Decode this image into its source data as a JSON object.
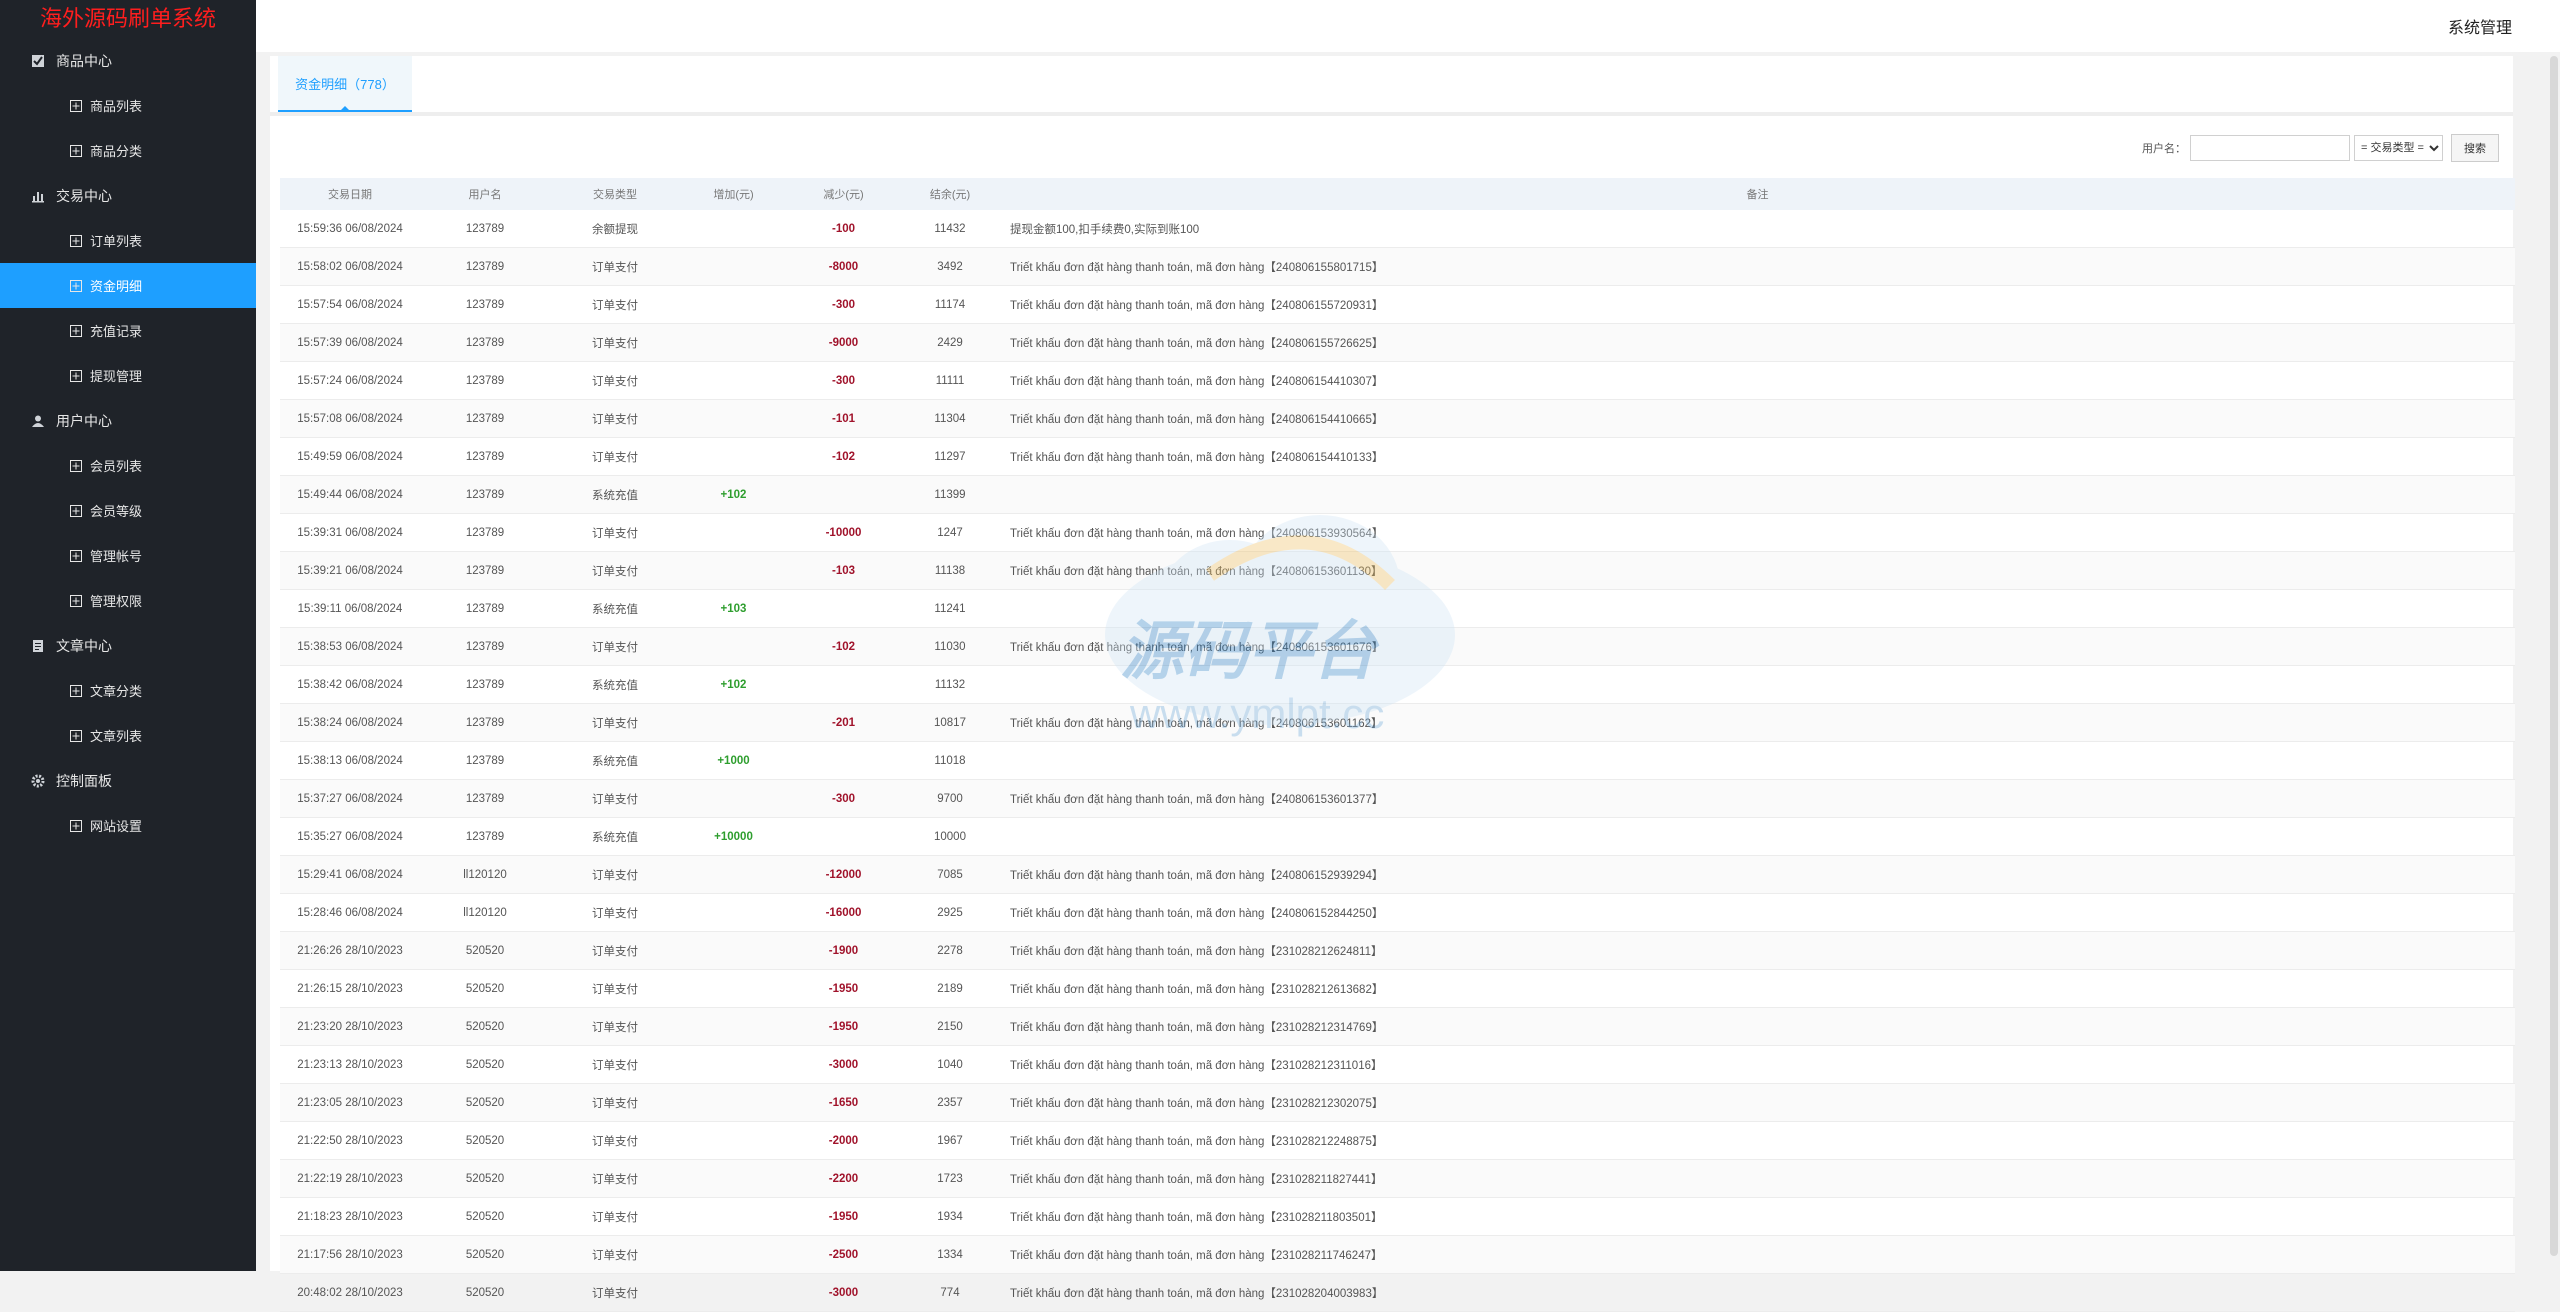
{
  "brand": "海外源码刷单系统",
  "header": {
    "title": "系统管理"
  },
  "sidebar": [
    {
      "label": "商品中心",
      "icon": "checkbox-icon",
      "items": [
        {
          "label": "商品列表"
        },
        {
          "label": "商品分类"
        }
      ]
    },
    {
      "label": "交易中心",
      "icon": "bar-chart-icon",
      "items": [
        {
          "label": "订单列表"
        },
        {
          "label": "资金明细",
          "active": true
        },
        {
          "label": "充值记录"
        },
        {
          "label": "提现管理"
        }
      ]
    },
    {
      "label": "用户中心",
      "icon": "user-icon",
      "items": [
        {
          "label": "会员列表"
        },
        {
          "label": "会员等级"
        },
        {
          "label": "管理帐号"
        },
        {
          "label": "管理权限"
        }
      ]
    },
    {
      "label": "文章中心",
      "icon": "document-icon",
      "items": [
        {
          "label": "文章分类"
        },
        {
          "label": "文章列表"
        }
      ]
    },
    {
      "label": "控制面板",
      "icon": "gear-icon",
      "items": [
        {
          "label": "网站设置"
        }
      ]
    }
  ],
  "tab": {
    "label": "资金明细（778）"
  },
  "filter": {
    "username_label": "用户名：",
    "username_value": "",
    "type_select": "= 交易类型 =",
    "search_label": "搜索"
  },
  "table": {
    "headers": [
      "交易日期",
      "用户名",
      "交易类型",
      "增加(元)",
      "减少(元)",
      "结余(元)",
      "备注"
    ],
    "rows": [
      [
        "15:59:36 06/08/2024",
        "123789",
        "余额提现",
        "",
        "-100",
        "11432",
        "提现金额100,扣手续费0,实际到账100"
      ],
      [
        "15:58:02 06/08/2024",
        "123789",
        "订单支付",
        "",
        "-8000",
        "3492",
        "Triết khấu đơn đặt hàng thanh toán, mã đơn hàng【240806155801715】"
      ],
      [
        "15:57:54 06/08/2024",
        "123789",
        "订单支付",
        "",
        "-300",
        "11174",
        "Triết khấu đơn đặt hàng thanh toán, mã đơn hàng【240806155720931】"
      ],
      [
        "15:57:39 06/08/2024",
        "123789",
        "订单支付",
        "",
        "-9000",
        "2429",
        "Triết khấu đơn đặt hàng thanh toán, mã đơn hàng【240806155726625】"
      ],
      [
        "15:57:24 06/08/2024",
        "123789",
        "订单支付",
        "",
        "-300",
        "11111",
        "Triết khấu đơn đặt hàng thanh toán, mã đơn hàng【240806154410307】"
      ],
      [
        "15:57:08 06/08/2024",
        "123789",
        "订单支付",
        "",
        "-101",
        "11304",
        "Triết khấu đơn đặt hàng thanh toán, mã đơn hàng【240806154410665】"
      ],
      [
        "15:49:59 06/08/2024",
        "123789",
        "订单支付",
        "",
        "-102",
        "11297",
        "Triết khấu đơn đặt hàng thanh toán, mã đơn hàng【240806154410133】"
      ],
      [
        "15:49:44 06/08/2024",
        "123789",
        "系统充值",
        "+102",
        "",
        "11399",
        ""
      ],
      [
        "15:39:31 06/08/2024",
        "123789",
        "订单支付",
        "",
        "-10000",
        "1247",
        "Triết khấu đơn đặt hàng thanh toán, mã đơn hàng【240806153930564】"
      ],
      [
        "15:39:21 06/08/2024",
        "123789",
        "订单支付",
        "",
        "-103",
        "11138",
        "Triết khấu đơn đặt hàng thanh toán, mã đơn hàng【240806153601130】"
      ],
      [
        "15:39:11 06/08/2024",
        "123789",
        "系统充值",
        "+103",
        "",
        "11241",
        ""
      ],
      [
        "15:38:53 06/08/2024",
        "123789",
        "订单支付",
        "",
        "-102",
        "11030",
        "Triết khấu đơn đặt hàng thanh toán, mã đơn hàng【240806153601676】"
      ],
      [
        "15:38:42 06/08/2024",
        "123789",
        "系统充值",
        "+102",
        "",
        "11132",
        ""
      ],
      [
        "15:38:24 06/08/2024",
        "123789",
        "订单支付",
        "",
        "-201",
        "10817",
        "Triết khấu đơn đặt hàng thanh toán, mã đơn hàng【240806153601162】"
      ],
      [
        "15:38:13 06/08/2024",
        "123789",
        "系统充值",
        "+1000",
        "",
        "11018",
        ""
      ],
      [
        "15:37:27 06/08/2024",
        "123789",
        "订单支付",
        "",
        "-300",
        "9700",
        "Triết khấu đơn đặt hàng thanh toán, mã đơn hàng【240806153601377】"
      ],
      [
        "15:35:27 06/08/2024",
        "123789",
        "系统充值",
        "+10000",
        "",
        "10000",
        ""
      ],
      [
        "15:29:41 06/08/2024",
        "ll120120",
        "订单支付",
        "",
        "-12000",
        "7085",
        "Triết khấu đơn đặt hàng thanh toán, mã đơn hàng【240806152939294】"
      ],
      [
        "15:28:46 06/08/2024",
        "ll120120",
        "订单支付",
        "",
        "-16000",
        "2925",
        "Triết khấu đơn đặt hàng thanh toán, mã đơn hàng【240806152844250】"
      ],
      [
        "21:26:26 28/10/2023",
        "520520",
        "订单支付",
        "",
        "-1900",
        "2278",
        "Triết khấu đơn đặt hàng thanh toán, mã đơn hàng【231028212624811】"
      ],
      [
        "21:26:15 28/10/2023",
        "520520",
        "订单支付",
        "",
        "-1950",
        "2189",
        "Triết khấu đơn đặt hàng thanh toán, mã đơn hàng【231028212613682】"
      ],
      [
        "21:23:20 28/10/2023",
        "520520",
        "订单支付",
        "",
        "-1950",
        "2150",
        "Triết khấu đơn đặt hàng thanh toán, mã đơn hàng【231028212314769】"
      ],
      [
        "21:23:13 28/10/2023",
        "520520",
        "订单支付",
        "",
        "-3000",
        "1040",
        "Triết khấu đơn đặt hàng thanh toán, mã đơn hàng【231028212311016】"
      ],
      [
        "21:23:05 28/10/2023",
        "520520",
        "订单支付",
        "",
        "-1650",
        "2357",
        "Triết khấu đơn đặt hàng thanh toán, mã đơn hàng【231028212302075】"
      ],
      [
        "21:22:50 28/10/2023",
        "520520",
        "订单支付",
        "",
        "-2000",
        "1967",
        "Triết khấu đơn đặt hàng thanh toán, mã đơn hàng【231028212248875】"
      ],
      [
        "21:22:19 28/10/2023",
        "520520",
        "订单支付",
        "",
        "-2200",
        "1723",
        "Triết khấu đơn đặt hàng thanh toán, mã đơn hàng【231028211827441】"
      ],
      [
        "21:18:23 28/10/2023",
        "520520",
        "订单支付",
        "",
        "-1950",
        "1934",
        "Triết khấu đơn đặt hàng thanh toán, mã đơn hàng【231028211803501】"
      ],
      [
        "21:17:56 28/10/2023",
        "520520",
        "订单支付",
        "",
        "-2500",
        "1334",
        "Triết khấu đơn đặt hàng thanh toán, mã đơn hàng【231028211746247】"
      ],
      [
        "20:48:02 28/10/2023",
        "520520",
        "订单支付",
        "",
        "-3000",
        "774",
        "Triết khấu đơn đặt hàng thanh toán, mã đơn hàng【231028204003983】"
      ]
    ]
  },
  "watermark": {
    "text": "源码平台",
    "url": "www.ymlpt.cc"
  },
  "colors": {
    "sidebar_bg": "#1f2329",
    "active": "#1e9fff",
    "brand": "#ff1e1e",
    "increase": "#2e9e2e",
    "decrease": "#a0132b"
  }
}
